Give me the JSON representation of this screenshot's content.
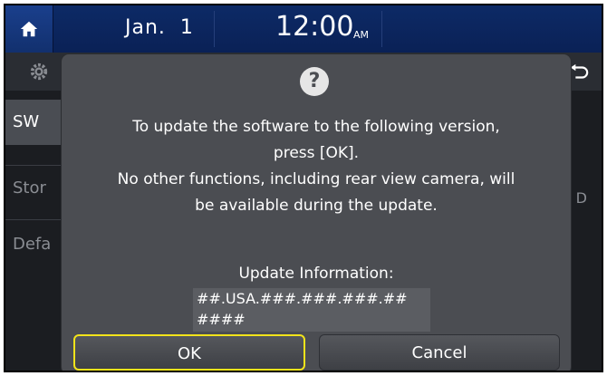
{
  "status_bar": {
    "date": "Jan.  1",
    "time": "12:00",
    "ampm": "AM"
  },
  "background_menu": {
    "items": [
      "SW",
      "Stor",
      "Defa"
    ],
    "right_text": "D"
  },
  "dialog": {
    "icon": "question-mark",
    "icon_glyph": "?",
    "message_lines": [
      "To update the software to the following version,",
      "press [OK].",
      "No other functions, including rear view camera, will",
      "be available during the update."
    ],
    "info_title": "Update Information:",
    "info_lines": [
      "##.USA.###.###.###.##",
      "####"
    ],
    "ok_label": "OK",
    "cancel_label": "Cancel"
  },
  "colors": {
    "top_bar": "#0d2a66",
    "dialog_bg": "#4b4d52",
    "ok_highlight": "#f2e31a"
  }
}
